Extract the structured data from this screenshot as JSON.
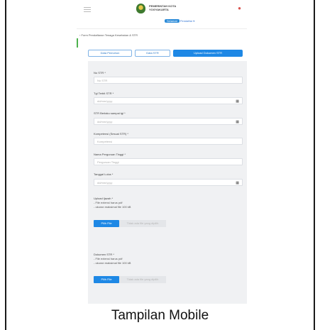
{
  "header": {
    "logo_line1": "PEMERINTAH KOTA",
    "logo_line2": "YOGYAKARTA",
    "user_badge": "Selamat",
    "user_name": "Pendaftar"
  },
  "breadcrumb": "‹ Form Pendaftaran Tenaga Kesehatan & STR",
  "tabs": [
    "Data Pemohon",
    "Data STR",
    "Upload Dokumen STR"
  ],
  "form": {
    "no_str_label": "No STR *",
    "no_str_placeholder": "No STR",
    "tgl_terbit_label": "Tgl Terbit STR *",
    "date_placeholder": "dd/mm/yyyy",
    "str_berlaku_label": "STR Berlaku sampai tgl *",
    "kompetensi_label": "Kompetensi (Sesuai STR) *",
    "kompetensi_placeholder": "Kompetensi",
    "perguruan_label": "Nama Perguruan Tinggi *",
    "perguruan_placeholder": "Perguruan Tinggi",
    "tgl_lulus_label": "Tanggal Lulus *",
    "upload_ijazah_label": "Upload Ijazah *",
    "note1": "- File extensi harus pdf",
    "note2": "- ukuran maksimal file 100 kB",
    "pick_label": "Pilih File",
    "no_file": "Tidak ada file yang dipilih",
    "dokumen_str_label": "Dokumen STR *"
  },
  "icons": {
    "calendar": "calendar-icon",
    "bell": "bell-icon",
    "menu": "hamburger-icon"
  },
  "caption": "Tampilan Mobile"
}
